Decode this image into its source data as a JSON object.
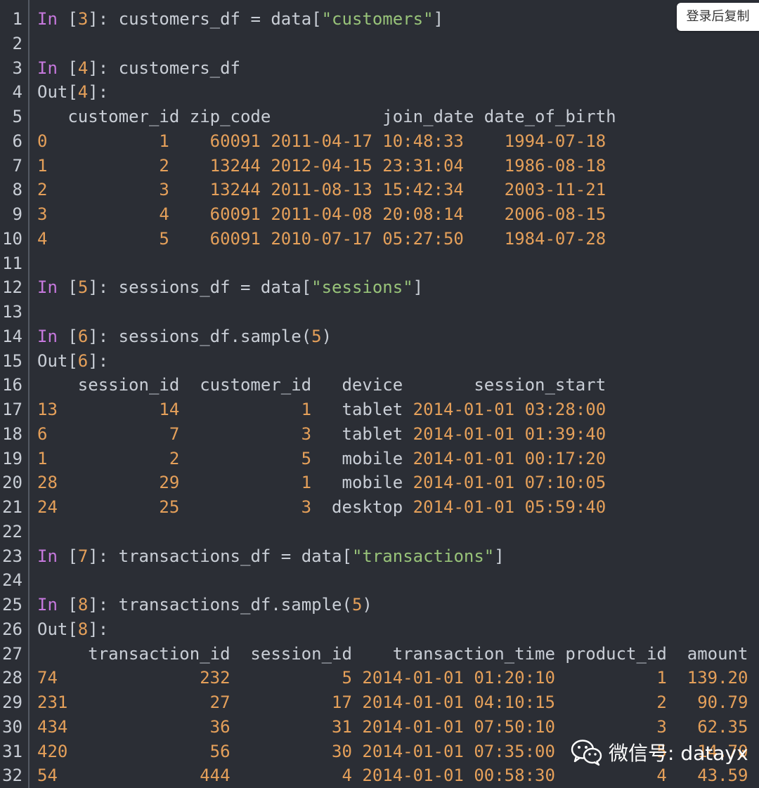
{
  "copy_button": {
    "label": "登录后复制"
  },
  "watermark": {
    "text": "微信号: datayx",
    "icon": "wechat-icon"
  },
  "colors": {
    "background": "#2b2e35",
    "keyword": "#c678dd",
    "number": "#e5a05a",
    "string": "#98c379",
    "text": "#c9ced6"
  },
  "lines": [
    {
      "n": "1",
      "tokens": [
        [
          "kw",
          "In"
        ],
        [
          "plain",
          " ["
        ],
        [
          "num",
          "3"
        ],
        [
          "plain",
          "]: customers_df = data["
        ],
        [
          "str",
          "\"customers\""
        ],
        [
          "plain",
          "]"
        ]
      ]
    },
    {
      "n": "2",
      "tokens": []
    },
    {
      "n": "3",
      "tokens": [
        [
          "kw",
          "In"
        ],
        [
          "plain",
          " ["
        ],
        [
          "num",
          "4"
        ],
        [
          "plain",
          "]: customers_df"
        ]
      ]
    },
    {
      "n": "4",
      "tokens": [
        [
          "plain",
          "Out["
        ],
        [
          "num",
          "4"
        ],
        [
          "plain",
          "]:"
        ]
      ]
    },
    {
      "n": "5",
      "tokens": [
        [
          "plain",
          "   customer_id zip_code           join_date date_of_birth"
        ]
      ]
    },
    {
      "n": "6",
      "tokens": [
        [
          "num",
          "0           1    60091 2011-04-17 10:48:33    1994-07-18"
        ]
      ]
    },
    {
      "n": "7",
      "tokens": [
        [
          "num",
          "1           2    13244 2012-04-15 23:31:04    1986-08-18"
        ]
      ]
    },
    {
      "n": "8",
      "tokens": [
        [
          "num",
          "2           3    13244 2011-08-13 15:42:34    2003-11-21"
        ]
      ]
    },
    {
      "n": "9",
      "tokens": [
        [
          "num",
          "3           4    60091 2011-04-08 20:08:14    2006-08-15"
        ]
      ]
    },
    {
      "n": "10",
      "tokens": [
        [
          "num",
          "4           5    60091 2010-07-17 05:27:50    1984-07-28"
        ]
      ]
    },
    {
      "n": "11",
      "tokens": []
    },
    {
      "n": "12",
      "tokens": [
        [
          "kw",
          "In"
        ],
        [
          "plain",
          " ["
        ],
        [
          "num",
          "5"
        ],
        [
          "plain",
          "]: sessions_df = data["
        ],
        [
          "str",
          "\"sessions\""
        ],
        [
          "plain",
          "]"
        ]
      ]
    },
    {
      "n": "13",
      "tokens": []
    },
    {
      "n": "14",
      "tokens": [
        [
          "kw",
          "In"
        ],
        [
          "plain",
          " ["
        ],
        [
          "num",
          "6"
        ],
        [
          "plain",
          "]: sessions_df.sample("
        ],
        [
          "num",
          "5"
        ],
        [
          "plain",
          ")"
        ]
      ]
    },
    {
      "n": "15",
      "tokens": [
        [
          "plain",
          "Out["
        ],
        [
          "num",
          "6"
        ],
        [
          "plain",
          "]:"
        ]
      ]
    },
    {
      "n": "16",
      "tokens": [
        [
          "plain",
          "    session_id  customer_id   device       session_start"
        ]
      ]
    },
    {
      "n": "17",
      "tokens": [
        [
          "num",
          "13          14            1"
        ],
        [
          "plain",
          "   tablet "
        ],
        [
          "num",
          "2014-01-01 03:28:00"
        ]
      ]
    },
    {
      "n": "18",
      "tokens": [
        [
          "num",
          "6            7            3"
        ],
        [
          "plain",
          "   tablet "
        ],
        [
          "num",
          "2014-01-01 01:39:40"
        ]
      ]
    },
    {
      "n": "19",
      "tokens": [
        [
          "num",
          "1            2            5"
        ],
        [
          "plain",
          "   mobile "
        ],
        [
          "num",
          "2014-01-01 00:17:20"
        ]
      ]
    },
    {
      "n": "20",
      "tokens": [
        [
          "num",
          "28          29            1"
        ],
        [
          "plain",
          "   mobile "
        ],
        [
          "num",
          "2014-01-01 07:10:05"
        ]
      ]
    },
    {
      "n": "21",
      "tokens": [
        [
          "num",
          "24          25            3"
        ],
        [
          "plain",
          "  desktop "
        ],
        [
          "num",
          "2014-01-01 05:59:40"
        ]
      ]
    },
    {
      "n": "22",
      "tokens": []
    },
    {
      "n": "23",
      "tokens": [
        [
          "kw",
          "In"
        ],
        [
          "plain",
          " ["
        ],
        [
          "num",
          "7"
        ],
        [
          "plain",
          "]: transactions_df = data["
        ],
        [
          "str",
          "\"transactions\""
        ],
        [
          "plain",
          "]"
        ]
      ]
    },
    {
      "n": "24",
      "tokens": []
    },
    {
      "n": "25",
      "tokens": [
        [
          "kw",
          "In"
        ],
        [
          "plain",
          " ["
        ],
        [
          "num",
          "8"
        ],
        [
          "plain",
          "]: transactions_df.sample("
        ],
        [
          "num",
          "5"
        ],
        [
          "plain",
          ")"
        ]
      ]
    },
    {
      "n": "26",
      "tokens": [
        [
          "plain",
          "Out["
        ],
        [
          "num",
          "8"
        ],
        [
          "plain",
          "]:"
        ]
      ]
    },
    {
      "n": "27",
      "tokens": [
        [
          "plain",
          "     transaction_id  session_id    transaction_time product_id  amount"
        ]
      ]
    },
    {
      "n": "28",
      "tokens": [
        [
          "num",
          "74              232           5 2014-01-01 01:20:10          1  139.20"
        ]
      ]
    },
    {
      "n": "29",
      "tokens": [
        [
          "num",
          "231              27          17 2014-01-01 04:10:15          2   90.79"
        ]
      ]
    },
    {
      "n": "30",
      "tokens": [
        [
          "num",
          "434              36          31 2014-01-01 07:50:10          3   62.35"
        ]
      ]
    },
    {
      "n": "31",
      "tokens": [
        [
          "num",
          "420              56          30 2014-01-01 07:35:00          5   14.70"
        ]
      ]
    },
    {
      "n": "32",
      "tokens": [
        [
          "num",
          "54              444           4 2014-01-01 00:58:30          4   43.59"
        ]
      ]
    }
  ]
}
